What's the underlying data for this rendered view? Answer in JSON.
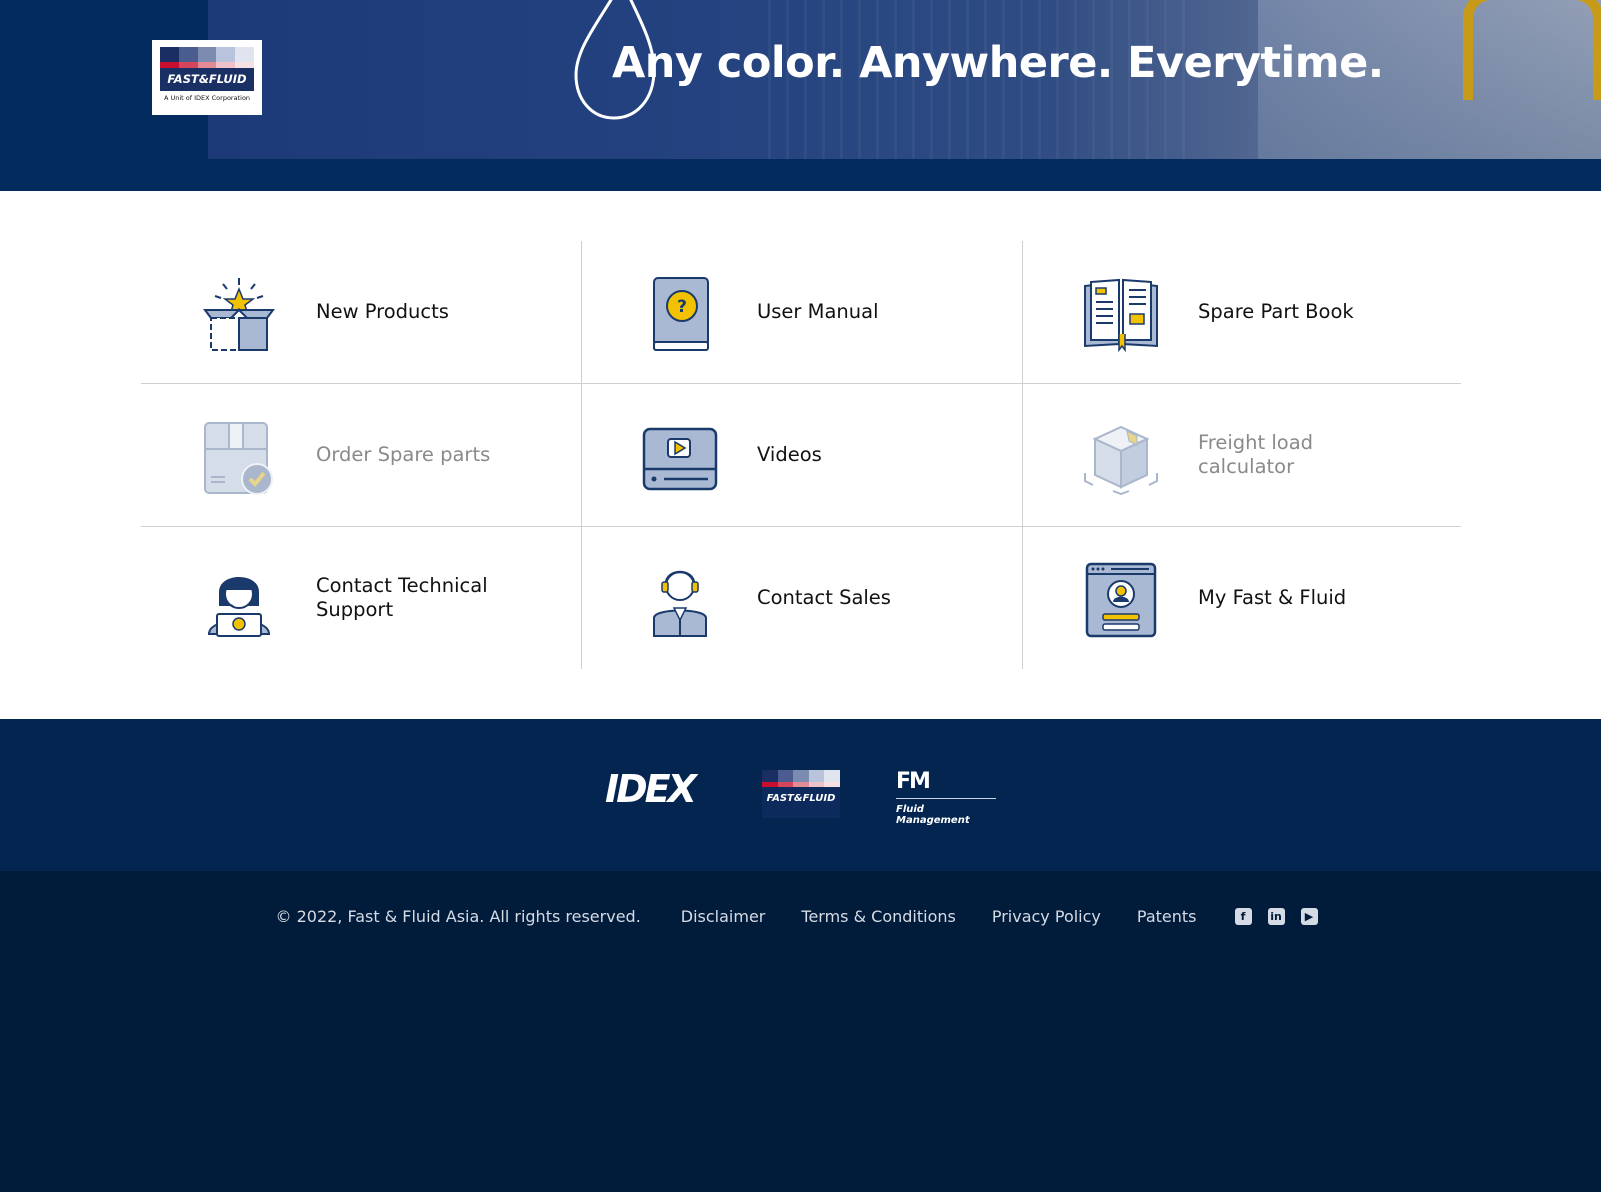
{
  "header": {
    "tagline": "Any color. Anywhere. Everytime.",
    "logo": {
      "name": "FAST&FLUID",
      "sub": "A Unit of IDEX Corporation"
    }
  },
  "tiles": [
    {
      "label": "New Products",
      "icon": "gift-box-star-icon",
      "muted": false
    },
    {
      "label": "User Manual",
      "icon": "question-book-icon",
      "muted": false
    },
    {
      "label": "Spare Part Book",
      "icon": "open-book-icon",
      "muted": false
    },
    {
      "label": "Order Spare parts",
      "icon": "package-check-icon",
      "muted": true
    },
    {
      "label": "Videos",
      "icon": "video-player-icon",
      "muted": false
    },
    {
      "label": "Freight load calculator",
      "icon": "freight-box-icon",
      "muted": true
    },
    {
      "label": "Contact Technical Support",
      "icon": "technical-support-agent-icon",
      "muted": false
    },
    {
      "label": "Contact Sales",
      "icon": "sales-agent-icon",
      "muted": false
    },
    {
      "label": "My Fast & Fluid",
      "icon": "user-profile-card-icon",
      "muted": false
    }
  ],
  "footer": {
    "brands": {
      "idex": "IDEX",
      "fast_fluid": "FAST&FLUID",
      "fm_mark": "FM",
      "fluid_management": "Fluid Management"
    },
    "copyright": "© 2022, Fast & Fluid Asia. All rights reserved.",
    "links": [
      "Disclaimer",
      "Terms & Conditions",
      "Privacy Policy",
      "Patents"
    ],
    "social": [
      "facebook-icon",
      "linkedin-icon",
      "youtube-icon"
    ]
  },
  "colors": {
    "navy": "#03254f",
    "footer_dark": "#011c3a",
    "icon_blue": "#1a3a6b",
    "icon_fill": "#a9b9d3",
    "accent_yellow": "#f2c200",
    "swatches": [
      "#1b2e63",
      "#4b5d8e",
      "#7c8bb0",
      "#b9c4dc",
      "#dfe4ee"
    ],
    "swatches_low": [
      "#c8102e",
      "#d7455c",
      "#e28a96",
      "#eec2c8",
      "#f5e1e4"
    ]
  }
}
